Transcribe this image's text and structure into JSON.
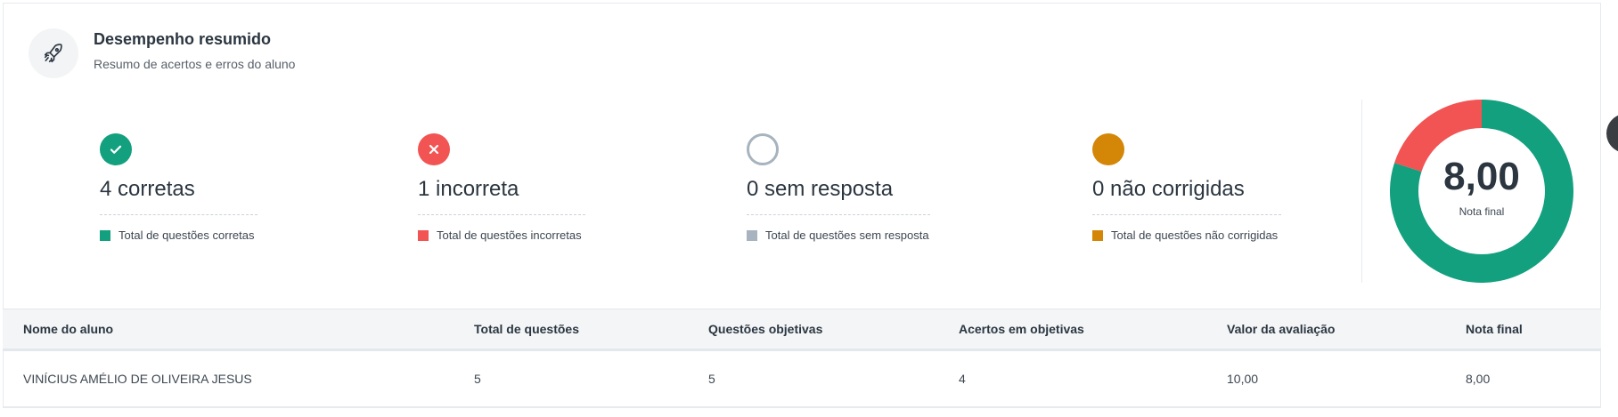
{
  "header": {
    "title": "Desempenho resumido",
    "subtitle": "Resumo de acertos e erros do aluno",
    "icon": "rocket-icon"
  },
  "stats": [
    {
      "id": "correct",
      "count": 4,
      "label": "4 corretas",
      "legend": "Total de questões corretas",
      "color": "#12a07e",
      "icon": "check-circle-icon"
    },
    {
      "id": "incorrect",
      "count": 1,
      "label": "1 incorreta",
      "legend": "Total de questões incorretas",
      "color": "#f25353",
      "icon": "x-circle-icon"
    },
    {
      "id": "unanswered",
      "count": 0,
      "label": "0 sem resposta",
      "legend": "Total de questões sem resposta",
      "color": "#a7b3be",
      "icon": "empty-circle-icon"
    },
    {
      "id": "uncorrected",
      "count": 0,
      "label": "0 não corrigidas",
      "legend": "Total de questões não corrigidas",
      "color": "#d48606",
      "icon": "filled-circle-icon"
    }
  ],
  "score": {
    "value": "8,00",
    "label": "Nota final"
  },
  "table": {
    "columns": [
      "Nome do aluno",
      "Total de questões",
      "Questões objetivas",
      "Acertos em objetivas",
      "Valor da avaliação",
      "Nota final"
    ],
    "rows": [
      [
        "VINÍCIUS AMÉLIO DE OLIVEIRA JESUS",
        "5",
        "5",
        "4",
        "10,00",
        "8,00"
      ]
    ]
  }
}
